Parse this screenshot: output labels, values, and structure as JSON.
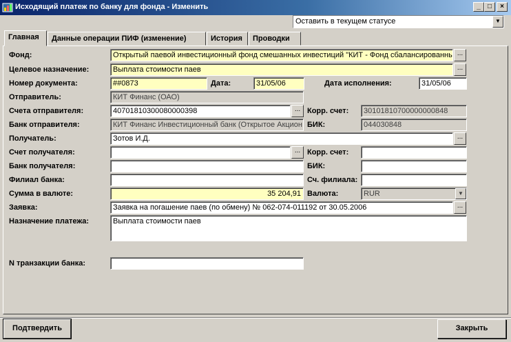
{
  "window": {
    "title": "Исходящий платеж по банку для фонда - Изменить"
  },
  "status_combo": {
    "value": "Оставить в текущем статусе"
  },
  "tabs": [
    {
      "label": "Главная"
    },
    {
      "label": "Данные операции ПИФ (изменение)"
    },
    {
      "label": "История"
    },
    {
      "label": "Проводки"
    }
  ],
  "form": {
    "fund": {
      "label": "Фонд:",
      "value": "Открытый паевой инвестиционный фонд смешанных инвестиций \"КИТ - Фонд сбалансированны"
    },
    "purpose": {
      "label": "Целевое назначение:",
      "value": "Выплата стоимости паев"
    },
    "doc_number": {
      "label": "Номер документа:",
      "value": "##0873"
    },
    "date": {
      "label": "Дата:",
      "value": "31/05/06"
    },
    "exec_date": {
      "label": "Дата исполнения:",
      "value": "31/05/06"
    },
    "sender": {
      "label": "Отправитель:",
      "value": "КИТ Финанс (ОАО)"
    },
    "sender_account": {
      "label": "Счета отправителя:",
      "value": "40701810300080000398"
    },
    "corr_account_1": {
      "label": "Корр. счет:",
      "value": "30101810700000000848"
    },
    "sender_bank": {
      "label": "Банк отправителя:",
      "value": "КИТ Финанс Инвестиционный банк (Открытое Акцион"
    },
    "bik_1": {
      "label": "БИК:",
      "value": "044030848"
    },
    "recipient": {
      "label": "Получатель:",
      "value": "Зотов И.Д."
    },
    "recipient_account": {
      "label": "Счет получателя:",
      "value": ""
    },
    "corr_account_2": {
      "label": "Корр. счет:",
      "value": ""
    },
    "recipient_bank": {
      "label": "Банк получателя:",
      "value": ""
    },
    "bik_2": {
      "label": "БИК:",
      "value": ""
    },
    "bank_branch": {
      "label": "Филиал банка:",
      "value": ""
    },
    "branch_account": {
      "label": "Сч. филиала:",
      "value": ""
    },
    "amount": {
      "label": "Сумма в валюте:",
      "value": "35 204,91"
    },
    "currency": {
      "label": "Валюта:",
      "value": "RUR"
    },
    "request": {
      "label": "Заявка:",
      "value": "Заявка на погашение паев (по обмену) № 062-074-011192 от 30.05.2006"
    },
    "payment_purpose": {
      "label": "Назначение платежа:",
      "value": "Выплата стоимости паев"
    },
    "transaction_no": {
      "label": "N транзакции банка:",
      "value": ""
    }
  },
  "buttons": {
    "confirm": "Подтвердить",
    "close": "Закрыть",
    "ellipsis": "...",
    "minimize": "_",
    "maximize": "□",
    "close_x": "×"
  }
}
